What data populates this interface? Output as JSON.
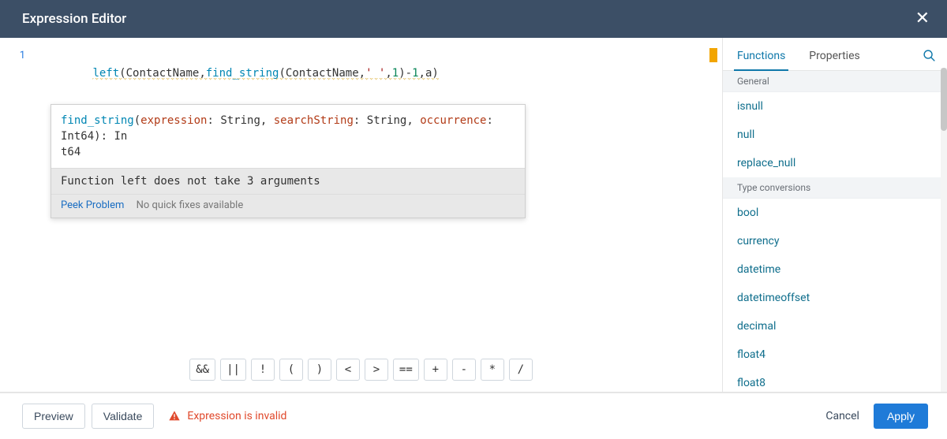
{
  "header": {
    "title": "Expression Editor"
  },
  "editor": {
    "line_number": "1",
    "code_html": "<span class='kw'>left</span>(<span class='id'>ContactName</span>,<span class='kw'>find_string</span>(<span class='id'>ContactName</span>,<span class='str'>' '</span>,<span class='num'>1</span>)-<span class='num'>1</span>,<span class='id'>a</span>)",
    "hint_sig_html": "<span class='fn'>find_string</span>(<span class='param'>expression</span>: <span class='type'>String</span>, <span class='param'>searchString</span>: <span class='type'>String</span>, <span class='param'>occurrence</span>: <span class='type'>Int64</span>): <span class='type'>In</span><br><span class='type'>t64</span>",
    "hint_error": "Function left does not take 3 arguments",
    "peek_label": "Peek Problem",
    "no_fix_label": "No quick fixes available"
  },
  "operators": [
    "&&",
    "||",
    "!",
    "(",
    ")",
    "<",
    ">",
    "==",
    "+",
    "-",
    "*",
    "/"
  ],
  "panel": {
    "tab_functions": "Functions",
    "tab_properties": "Properties",
    "groups": [
      {
        "label": "General",
        "items": [
          "isnull",
          "null",
          "replace_null"
        ]
      },
      {
        "label": "Type conversions",
        "items": [
          "bool",
          "currency",
          "datetime",
          "datetimeoffset",
          "decimal",
          "float4",
          "float8"
        ]
      }
    ]
  },
  "footer": {
    "preview": "Preview",
    "validate": "Validate",
    "status": "Expression is invalid",
    "cancel": "Cancel",
    "apply": "Apply"
  }
}
